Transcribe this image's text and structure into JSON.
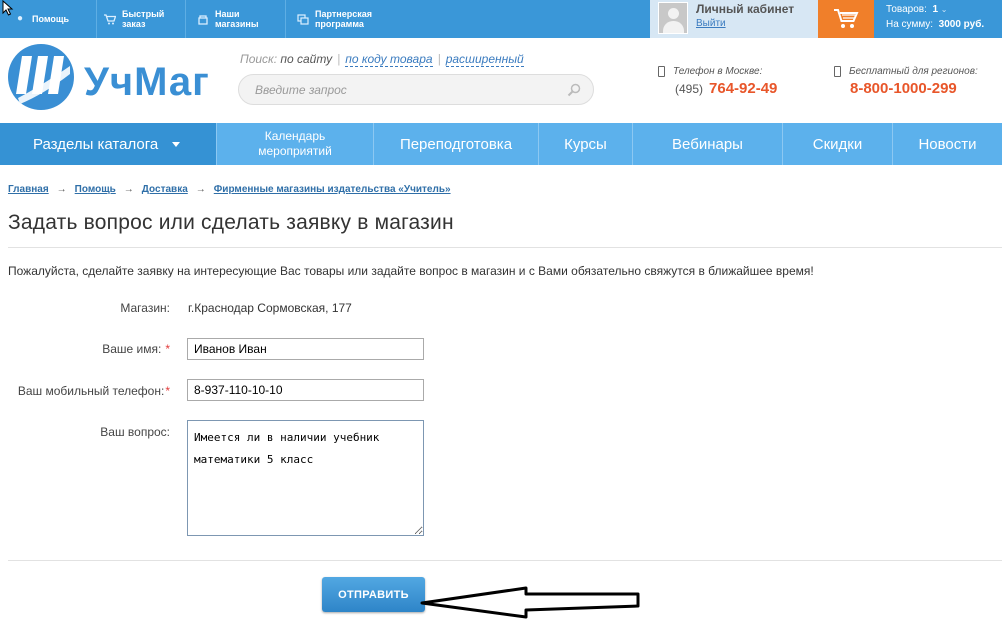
{
  "topbar": {
    "links": [
      {
        "label": "Помощь",
        "icon": "help-icon"
      },
      {
        "label_line1": "Быстрый",
        "label_line2": "заказ",
        "icon": "quick-cart-icon"
      },
      {
        "label_line1": "Наши",
        "label_line2": "магазины",
        "icon": "store-icon"
      },
      {
        "label_line1": "Партнерская",
        "label_line2": "программа",
        "icon": "partner-icon"
      }
    ],
    "cabinet": {
      "title": "Личный кабинет",
      "logout": "Выйти"
    },
    "cart": {
      "items_label": "Товаров:",
      "items_count": "1",
      "sum_label": "На сумму:",
      "sum_value": "3000 руб."
    }
  },
  "header": {
    "logo_text": "УчМаг",
    "search": {
      "prefix": "Поиск:",
      "current": "по сайту",
      "link_code": "по коду товара",
      "link_advanced": "расширенный",
      "placeholder": "Введите запрос"
    },
    "phone_moscow": {
      "label": "Телефон в Москве:",
      "code": "(495)",
      "number": "764-92-49"
    },
    "phone_free": {
      "label": "Бесплатный для регионов:",
      "number": "8-800-1000-299"
    }
  },
  "nav": {
    "catalog": "Разделы каталога",
    "calendar_line1": "Календарь",
    "calendar_line2": "мероприятий",
    "items": [
      "Переподготовка",
      "Курсы",
      "Вебинары",
      "Скидки",
      "Новости"
    ]
  },
  "breadcrumb": [
    "Главная",
    "Помощь",
    "Доставка",
    "Фирменные магазины издательства «Учитель»"
  ],
  "page": {
    "title": "Задать вопрос или сделать заявку в магазин",
    "intro": "Пожалуйста, сделайте заявку на интересующие Вас товары или задайте вопрос в магазин и с Вами обязательно свяжутся в ближайшее время!"
  },
  "form": {
    "store_label": "Магазин:",
    "store_value": "г.Краснодар Сормовская, 177",
    "name_label": "Ваше имя:",
    "name_value": "Иванов Иван",
    "phone_label": "Ваш мобильный телефон:",
    "phone_value": "8-937-110-10-10",
    "question_label": "Ваш вопрос:",
    "question_value": "Имеется ли в наличии учебник математики 5 класс",
    "required_mark": "*",
    "submit_label": "ОТПРАВИТЬ"
  },
  "colors": {
    "topbar": "#3a97d8",
    "nav": "#5cb1ec",
    "nav_active": "#3592d4",
    "cart": "#f07f2a",
    "accent_phone": "#e8562a",
    "logo": "#3a8fd4"
  }
}
